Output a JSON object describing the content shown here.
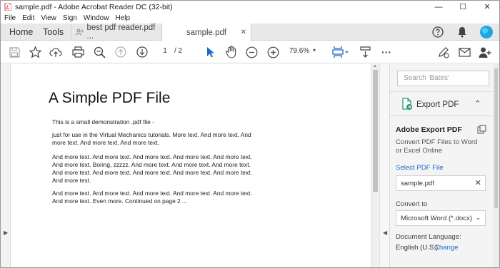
{
  "window": {
    "title": "sample.pdf - Adobe Acrobat Reader DC (32-bit)",
    "controls": {
      "minimize": "—",
      "maximize": "☐",
      "close": "✕"
    }
  },
  "menu": [
    "File",
    "Edit",
    "View",
    "Sign",
    "Window",
    "Help"
  ],
  "tabs": {
    "home": "Home",
    "tools": "Tools",
    "documents": [
      {
        "label": "best pdf reader.pdf ...",
        "active": false
      },
      {
        "label": "sample.pdf",
        "active": true,
        "close": "✕"
      }
    ]
  },
  "toolbar": {
    "icons": [
      "save-icon",
      "star-icon",
      "upload-icon",
      "print-icon",
      "search-icon",
      "page-up-icon",
      "page-down-icon",
      "select-cursor-icon",
      "hand-icon",
      "zoom-out-icon",
      "zoom-in-icon",
      "fit-page-icon",
      "scroll-mode-icon",
      "more-icon",
      "sign-icon",
      "mail-icon",
      "add-user-icon"
    ],
    "page_current": "1",
    "page_total": "/ 2",
    "zoom": "79.6%",
    "zoom_caret": "▾",
    "more": "···"
  },
  "document": {
    "title": "A Simple PDF File",
    "paragraphs": [
      "This is a small demonstration .pdf file -",
      "just for use in the Virtual Mechanics tutorials. More text. And more text. And more text. And more text. And more text.",
      "And more text. And more text. And more text. And more text. And more text. And more text. Boring, zzzzz. And more text. And more text. And more text. And more text. And more text. And more text. And more text. And more text. And more text.",
      "And more text. And more text. And more text. And more text. And more text. And more text. Even more. Continued on page 2 ..."
    ]
  },
  "right_pane": {
    "search_placeholder": "Search 'Bates'",
    "export_section": "Export PDF",
    "export_caret": "⌃",
    "adobe_export_title": "Adobe Export PDF",
    "adobe_export_desc": "Convert PDF Files to Word or Excel Online",
    "select_file_label": "Select PDF File",
    "selected_file": "sample.pdf",
    "clear": "✕",
    "convert_to_label": "Convert to",
    "convert_to_value": "Microsoft Word (*.docx)",
    "convert_chevron": "⌄",
    "doc_language_label": "Document Language:",
    "doc_language_value": "English (U.S.)",
    "change_link": "Change"
  },
  "colors": {
    "accent_blue": "#1e6bc4",
    "pdf_red": "#d7373f",
    "tab_bar_bg": "#e8e8e8",
    "pane_bg": "#f4f4f4"
  }
}
